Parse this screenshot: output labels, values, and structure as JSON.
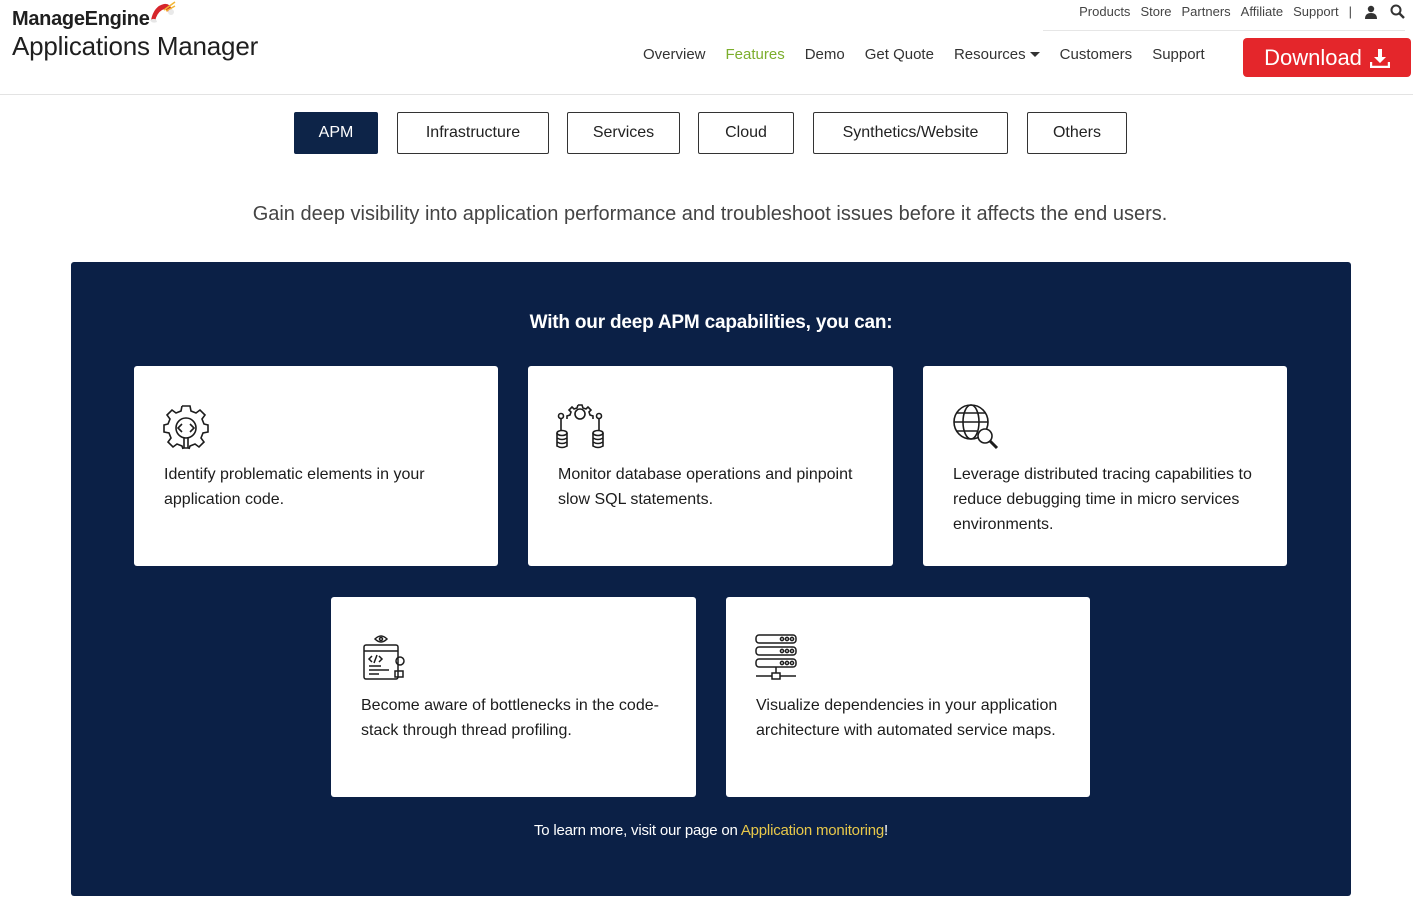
{
  "header": {
    "brand": "ManageEngine",
    "product": "Applications Manager",
    "top_links": [
      "Products",
      "Store",
      "Partners",
      "Affiliate",
      "Support"
    ],
    "separator": "|",
    "top_icons": [
      "user-icon",
      "search-icon"
    ],
    "nav": [
      {
        "label": "Overview",
        "active": false
      },
      {
        "label": "Features",
        "active": true
      },
      {
        "label": "Demo",
        "active": false
      },
      {
        "label": "Get Quote",
        "active": false
      },
      {
        "label": "Resources",
        "active": false,
        "dropdown": true
      },
      {
        "label": "Customers",
        "active": false
      },
      {
        "label": "Support",
        "active": false
      }
    ],
    "download_label": "Download",
    "colors": {
      "accent_green": "#7cae2c",
      "download_red": "#e4262b"
    }
  },
  "tabs": [
    {
      "label": "APM",
      "active": true
    },
    {
      "label": "Infrastructure",
      "active": false
    },
    {
      "label": "Services",
      "active": false
    },
    {
      "label": "Cloud",
      "active": false
    },
    {
      "label": "Synthetics/Website",
      "active": false
    },
    {
      "label": "Others",
      "active": false
    }
  ],
  "tagline": "Gain deep visibility into application performance and troubleshoot issues before it affects the end users.",
  "panel": {
    "title": "With our deep APM capabilities, you can:",
    "background": "#0b2046",
    "cards": [
      {
        "icon": "code-gear-icon",
        "text": "Identify problematic elements in your application code."
      },
      {
        "icon": "database-gear-icon",
        "text": "Monitor database operations and pinpoint slow SQL statements."
      },
      {
        "icon": "globe-search-icon",
        "text": "Leverage distributed tracing capabilities to reduce debugging time in micro services environments."
      },
      {
        "icon": "code-window-icon",
        "text": "Become aware of bottlenecks in the code-stack through thread profiling."
      },
      {
        "icon": "server-stack-icon",
        "text": "Visualize dependencies in your application architecture with automated service maps."
      }
    ],
    "footnote_prefix": "To learn more, visit our page on ",
    "footnote_link": "Application monitoring",
    "footnote_suffix": "!"
  }
}
